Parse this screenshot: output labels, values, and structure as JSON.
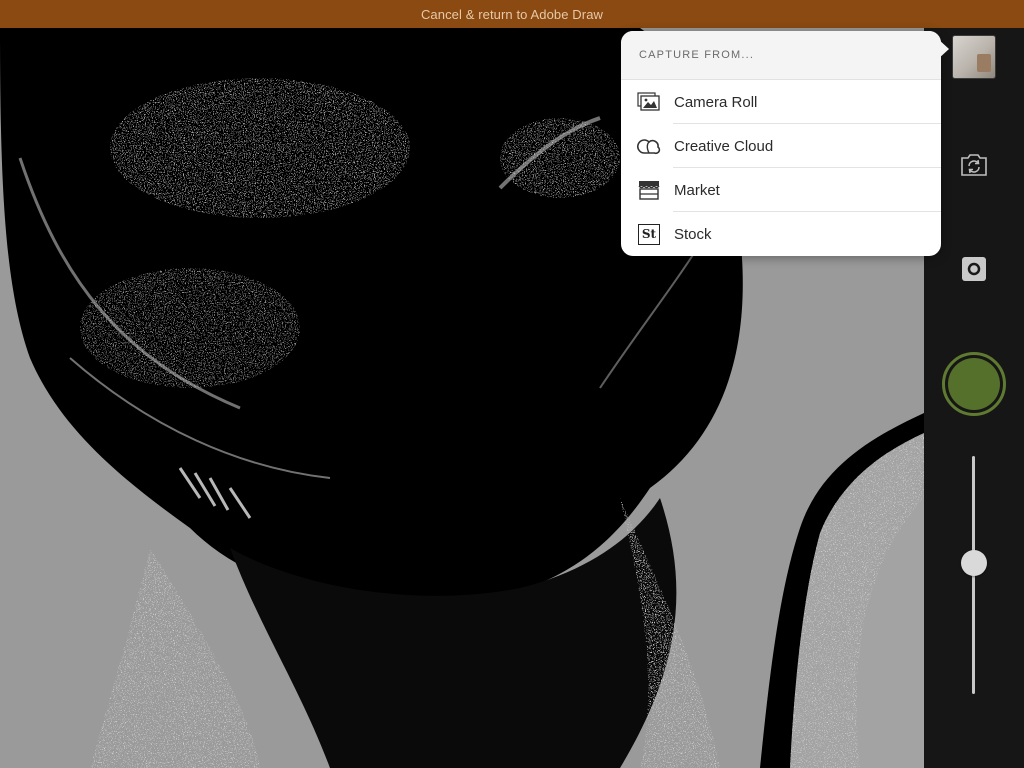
{
  "banner": {
    "label": "Cancel & return to Adobe Draw",
    "color": "#8a4a12"
  },
  "popover": {
    "header": "CAPTURE FROM...",
    "items": [
      {
        "label": "Camera Roll",
        "icon": "camera-roll-icon"
      },
      {
        "label": "Creative Cloud",
        "icon": "creative-cloud-icon"
      },
      {
        "label": "Market",
        "icon": "market-icon"
      },
      {
        "label": "Stock",
        "icon": "stock-icon",
        "icon_text": "St"
      }
    ]
  },
  "controls": {
    "thumbnail_icon": "recent-capture-thumbnail",
    "flip_icon": "flip-camera-icon",
    "mode_icon": "square-mode-icon",
    "shutter_color": "#55702a",
    "slider_value": 0.55
  },
  "viewfinder": {
    "background": "#9a9a9a",
    "subject": "high-contrast black and white threshold image"
  }
}
